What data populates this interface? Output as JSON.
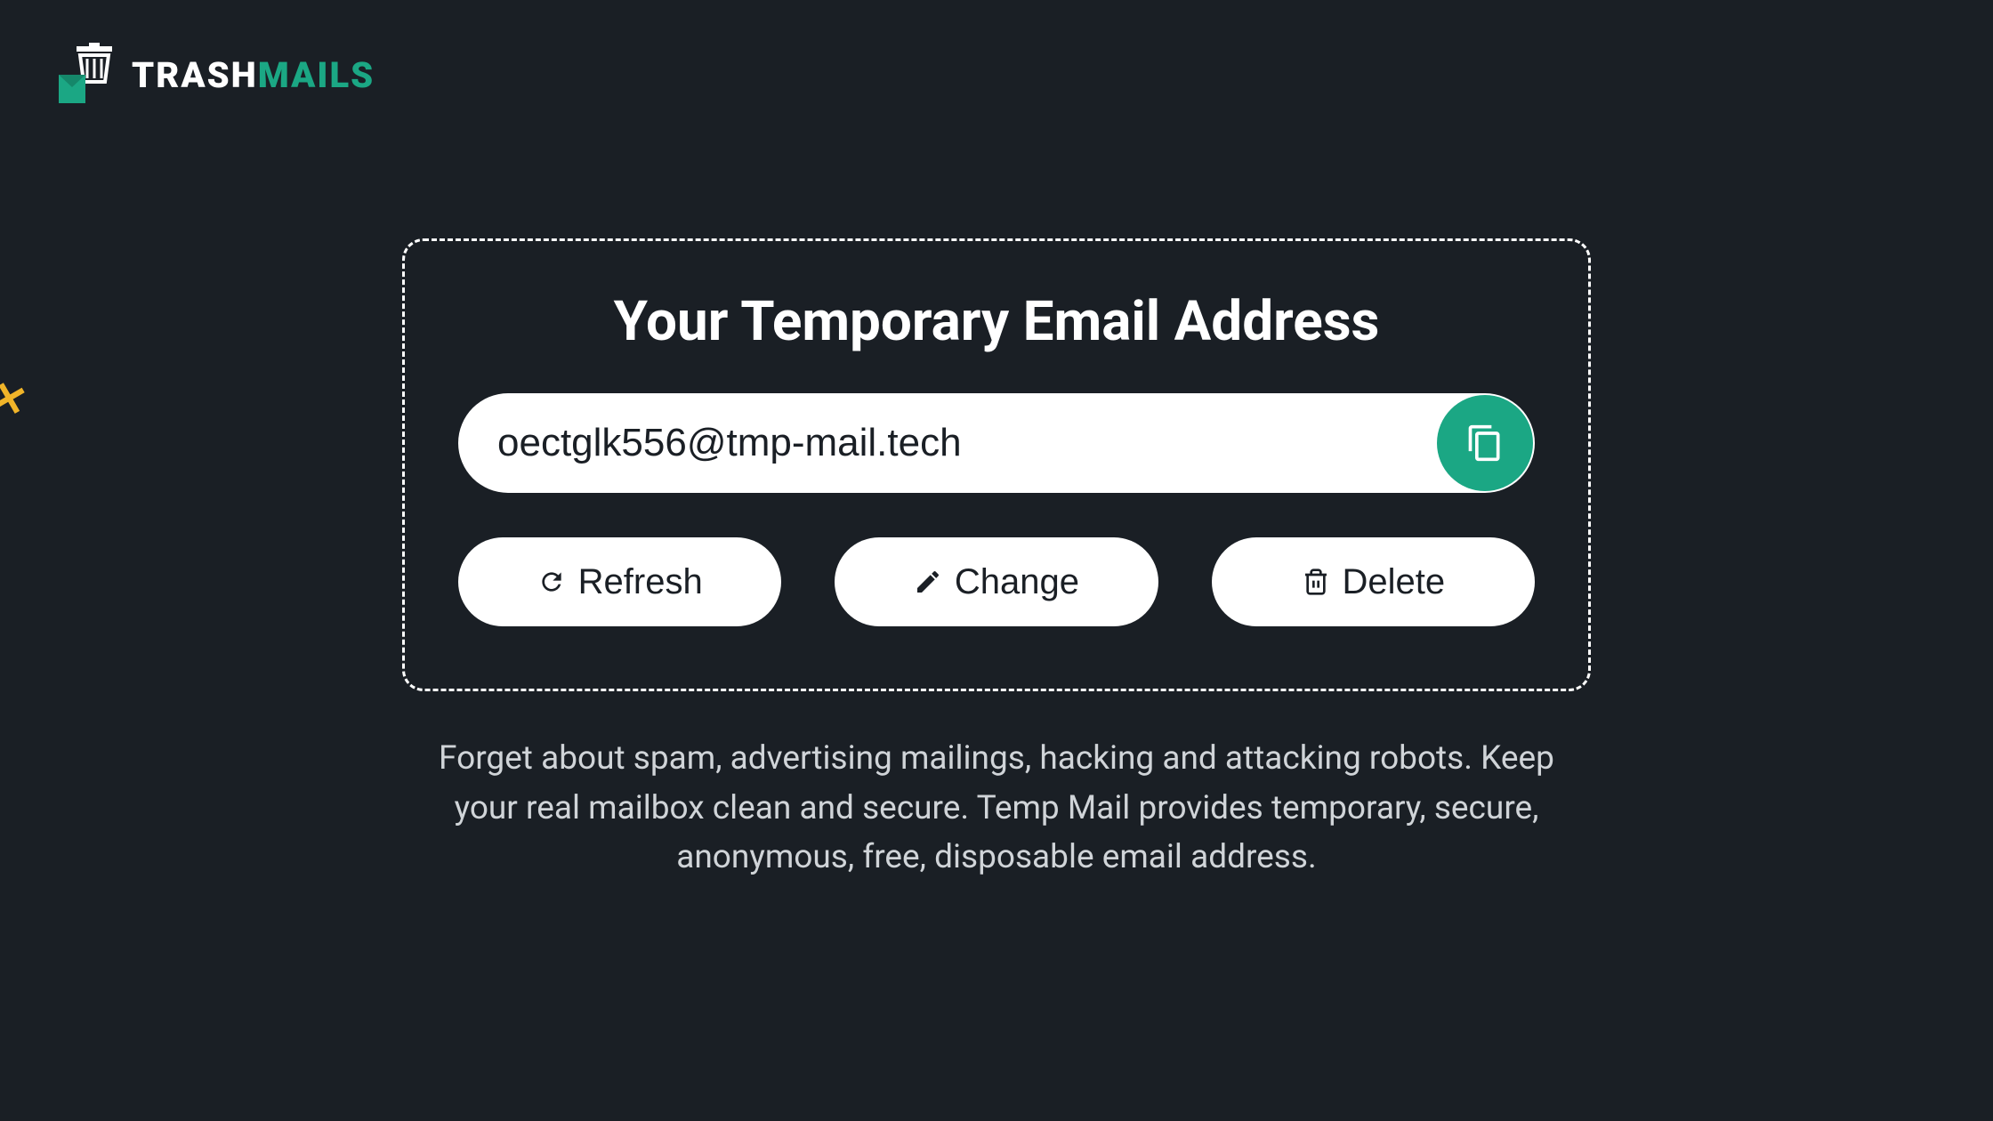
{
  "header": {
    "logo_trash": "TRASH",
    "logo_mails": "MAILS"
  },
  "card": {
    "title": "Your Temporary Email Address",
    "email_value": "oectglk556@tmp-mail.tech"
  },
  "buttons": {
    "refresh_label": "Refresh",
    "change_label": "Change",
    "delete_label": "Delete"
  },
  "description": "Forget about spam, advertising mailings, hacking and attacking robots. Keep your real mailbox clean and secure. Temp Mail provides temporary, secure, anonymous, free, disposable email address."
}
